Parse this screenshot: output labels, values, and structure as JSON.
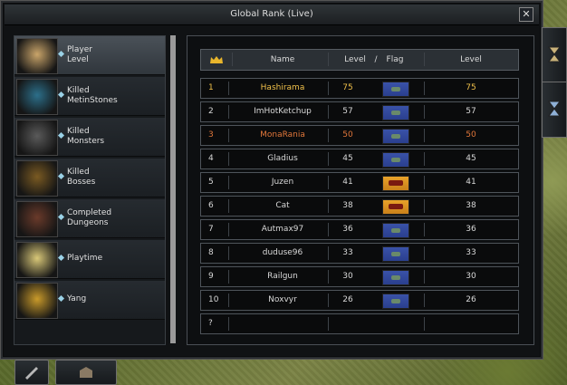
{
  "window": {
    "title": "Global Rank (Live)",
    "close_label": "✕"
  },
  "sidebar": {
    "items": [
      {
        "line1": "Player",
        "line2": "Level",
        "icon": "warrior-portrait-icon",
        "active": true
      },
      {
        "line1": "Killed",
        "line2": "MetinStones",
        "icon": "metin-stone-icon",
        "active": false
      },
      {
        "line1": "Killed",
        "line2": "Monsters",
        "icon": "monster-icon",
        "active": false
      },
      {
        "line1": "Killed",
        "line2": "Bosses",
        "icon": "boss-icon",
        "active": false
      },
      {
        "line1": "Completed",
        "line2": "Dungeons",
        "icon": "dungeon-icon",
        "active": false
      },
      {
        "line1": "Playtime",
        "line2": "",
        "icon": "stopwatch-icon",
        "active": false
      },
      {
        "line1": "Yang",
        "line2": "",
        "icon": "gold-bars-icon",
        "active": false
      }
    ]
  },
  "table": {
    "headers": {
      "rank_icon": "crown-icon",
      "name": "Name",
      "level": "Level",
      "slash": "/",
      "flag": "Flag",
      "level2": "Level"
    },
    "rows": [
      {
        "rank": "1",
        "name": "Hashirama",
        "level": "75",
        "flag": "blue",
        "level2": "75",
        "color": "gold"
      },
      {
        "rank": "2",
        "name": "ImHotKetchup",
        "level": "57",
        "flag": "blue",
        "level2": "57",
        "color": "normal"
      },
      {
        "rank": "3",
        "name": "MonaRania",
        "level": "50",
        "flag": "blue",
        "level2": "50",
        "color": "orange"
      },
      {
        "rank": "4",
        "name": "Gladius",
        "level": "45",
        "flag": "blue",
        "level2": "45",
        "color": "normal"
      },
      {
        "rank": "5",
        "name": "Juzen",
        "level": "41",
        "flag": "orange",
        "level2": "41",
        "color": "normal"
      },
      {
        "rank": "6",
        "name": "Cat",
        "level": "38",
        "flag": "orange",
        "level2": "38",
        "color": "normal"
      },
      {
        "rank": "7",
        "name": "Autmax97",
        "level": "36",
        "flag": "blue",
        "level2": "36",
        "color": "normal"
      },
      {
        "rank": "8",
        "name": "duduse96",
        "level": "33",
        "flag": "blue",
        "level2": "33",
        "color": "normal"
      },
      {
        "rank": "9",
        "name": "Railgun",
        "level": "30",
        "flag": "blue",
        "level2": "30",
        "color": "normal"
      },
      {
        "rank": "10",
        "name": "Noxvyr",
        "level": "26",
        "flag": "blue",
        "level2": "26",
        "color": "normal"
      }
    ],
    "self_row": {
      "rank": "?",
      "name": "",
      "level": "",
      "level2": ""
    }
  },
  "colors": {
    "gold": "#f0c04a",
    "orange": "#e0763a",
    "normal": "#d8d8d8"
  }
}
